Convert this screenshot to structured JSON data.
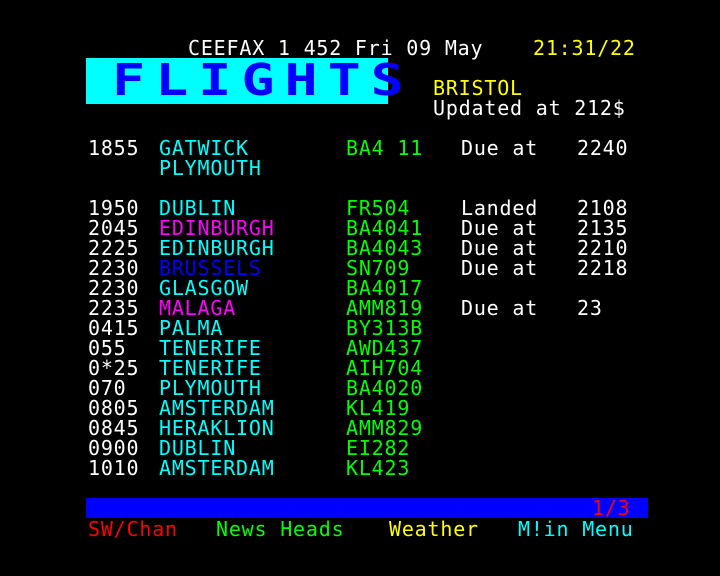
{
  "header": {
    "service": "CEEFAX 1 452 Fri 09 May",
    "clock": "21:31/22"
  },
  "banner": {
    "title": "FLIGHTS"
  },
  "airport": {
    "name": "BRISTOL",
    "updated": "Updated at 212$"
  },
  "flights": [
    {
      "time": "1855",
      "dest": "GATWICK",
      "flight": "BA4 11",
      "status": "Due at",
      "status_time": "2240",
      "color": "#00ffff"
    },
    {
      "time": "",
      "dest": "PLYMOUTH",
      "flight": "",
      "status": "",
      "status_time": "",
      "color": "#00ffff"
    },
    {
      "time": "1950",
      "dest": "DUBLIN",
      "flight": "FR504",
      "status": "Landed",
      "status_time": "2108",
      "color": "#00ffff"
    },
    {
      "time": "2045",
      "dest": "EDINBURGH",
      "flight": "BA4041",
      "status": "Due at",
      "status_time": "2135",
      "color": "#ff00ff"
    },
    {
      "time": "2225",
      "dest": "EDINBURGH",
      "flight": "BA4043",
      "status": "Due at",
      "status_time": "2210",
      "color": "#00ffff"
    },
    {
      "time": "2230",
      "dest": "BRUSSELS",
      "flight": "SN709",
      "status": "Due at",
      "status_time": "2218",
      "color": "#0000ff"
    },
    {
      "time": "2230",
      "dest": "GLASGOW",
      "flight": "BA4017",
      "status": "",
      "status_time": "",
      "color": "#00ffff"
    },
    {
      "time": "2235",
      "dest": "MALAGA",
      "flight": "AMM819",
      "status": "Due at",
      "status_time": "23",
      "color": "#ff00ff"
    },
    {
      "time": "0415",
      "dest": "PALMA",
      "flight": "BY313B",
      "status": "",
      "status_time": "",
      "color": "#00ffff"
    },
    {
      "time": "055",
      "dest": "TENERIFE",
      "flight": "AWD437",
      "status": "",
      "status_time": "",
      "color": "#00ffff"
    },
    {
      "time": "0*25",
      "dest": "TENERIFE",
      "flight": "AIH704",
      "status": "",
      "status_time": "",
      "color": "#00ffff"
    },
    {
      "time": "070",
      "dest": "PLYMOUTH",
      "flight": "BA4020",
      "status": "",
      "status_time": "",
      "color": "#00ffff"
    },
    {
      "time": "0805",
      "dest": "AMSTERDAM",
      "flight": "KL419",
      "status": "",
      "status_time": "",
      "color": "#00ffff"
    },
    {
      "time": "0845",
      "dest": "HERAKLION",
      "flight": "AMM829",
      "status": "",
      "status_time": "",
      "color": "#00ffff"
    },
    {
      "time": "0900",
      "dest": "DUBLIN",
      "flight": "EI282",
      "status": "",
      "status_time": "",
      "color": "#00ffff"
    },
    {
      "time": "1010",
      "dest": "AMSTERDAM",
      "flight": "KL423",
      "status": "",
      "status_time": "",
      "color": "#00ffff"
    }
  ],
  "page_counter": "1/3",
  "fastext": {
    "red": "SW/Chan",
    "green": "News Heads",
    "yellow": "Weather",
    "cyan": "M!in Menu"
  }
}
